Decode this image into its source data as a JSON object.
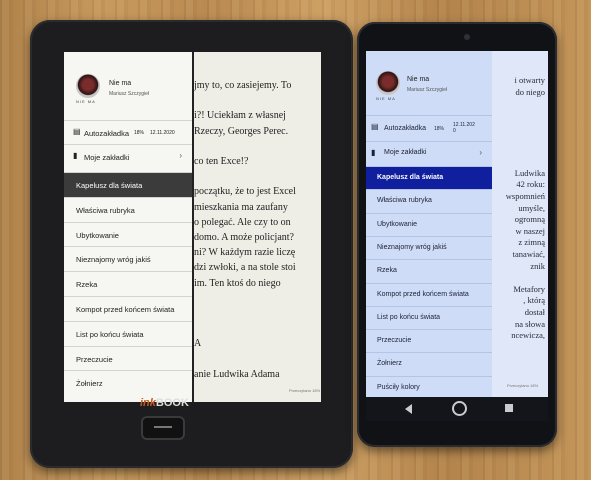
{
  "ereader": {
    "brand_prefix": "ink",
    "brand_name": "BOOK",
    "header": {
      "title": "Nie ma",
      "author": "Mariusz Szczygieł",
      "avatar_caption": "NIE MA"
    },
    "bookmark": {
      "label": "Autozakładka",
      "percent": "18%",
      "date": "12.11.2020"
    },
    "my_bookmarks": "Moje zakładki",
    "chapters": [
      "Kapelusz dla świata",
      "Właściwa rubryka",
      "Ubytkowanie",
      "Nieznajomy wróg jakiś",
      "Rzeka",
      "Kompot przed końcem świata",
      "List po końcu świata",
      "Przeczucie",
      "Żołnierz"
    ],
    "active_chapter": "Kapelusz dla świata",
    "page_lines": [
      "jmy to, co zasiejemy. To",
      "",
      "i?! Uciekłam z własnej",
      "Rzeczy, Georges Perec.",
      "",
      "co ten Exce!?",
      "",
      "początku, że to jest Excel",
      "mieszkania ma zaufany",
      "o polegać. Ale czy to on",
      "domo. A może policjant?",
      "ni? W każdym razie liczę",
      "dzi zwłoki, a na stole stoi",
      "im. Ten ktoś do niego",
      "",
      "",
      "",
      "A",
      "",
      "anie Ludwika Adama"
    ],
    "footer": "Przeczytano 18%"
  },
  "phone": {
    "header": {
      "title": "Nie ma",
      "author": "Mariusz Szczygieł",
      "avatar_caption": "NIE MA"
    },
    "bookmark": {
      "label": "Autozakładka",
      "percent": "18%",
      "date": "12.11.202 0"
    },
    "my_bookmarks": "Moje zakładki",
    "chapters": [
      "Kapelusz dla świata",
      "Właściwa rubryka",
      "Ubytkowanie",
      "Nieznajomy wróg jakiś",
      "Rzeka",
      "Kompot przed końcem świata",
      "List po końcu świata",
      "Przeczucie",
      "Żołnierz",
      "Puściły kolory"
    ],
    "active_chapter": "Kapelusz dla świata",
    "page_lines": [
      "i otwarty",
      "do niego",
      "",
      "",
      "",
      "",
      "",
      "",
      "Ludwika",
      "42 roku:",
      "wspomnień",
      "umyśle,",
      "ogromną",
      "w naszej",
      "z zimną",
      "tanawiać,",
      "znik",
      "",
      "Metafory",
      ", którą",
      "dostał",
      "na słowa",
      "ncewicza,"
    ],
    "footer": "Przeczytano 18%"
  },
  "icons": {
    "bookmark": "bookmark-icon",
    "flag": "flag-icon",
    "chevron": "chevron-right-icon"
  },
  "colors": {
    "ereader_active": "#3b3b3b",
    "phone_active": "#0f1f9e",
    "brand": "#c45a20"
  }
}
